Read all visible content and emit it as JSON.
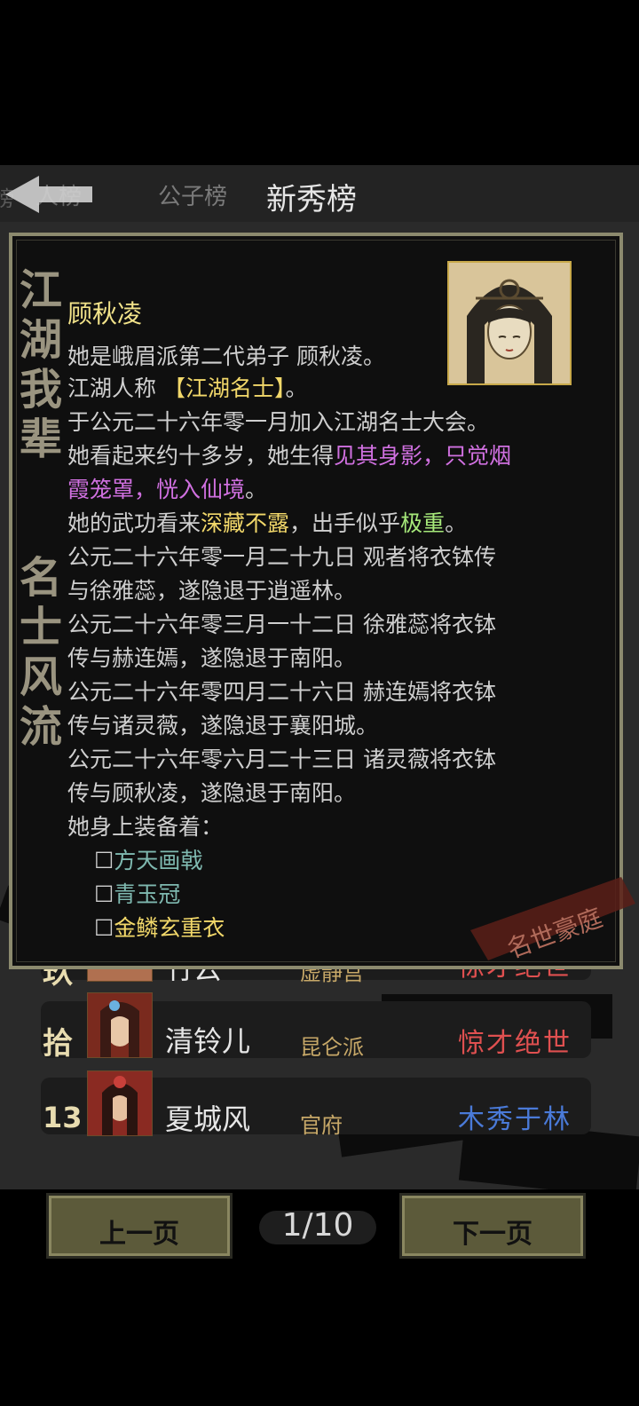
{
  "tabs": {
    "far": "榜",
    "renbang": "人榜",
    "gongzi": "公子榜",
    "xinxiu": "新秀榜"
  },
  "panel": {
    "side_text_1": [
      "江",
      "湖",
      "我",
      "辈"
    ],
    "side_text_2": [
      "名",
      "士",
      "风",
      "流"
    ],
    "name": "顾秋凌",
    "lines": {
      "l1": "她是峨眉派第二代弟子 顾秋凌。",
      "l2a": "江湖人称 ",
      "l2b": "【江湖名士】",
      "l2c": "。",
      "l3": "于公元二十六年零一月加入江湖名士大会。",
      "l4a": "她看起来约十多岁，她生得",
      "l4b": "见其身影，只觉烟",
      "l5a": "霞笼罩，恍入仙境",
      "l5b": "。",
      "l6a": "她的武功看来",
      "l6b": "深藏不露",
      "l6c": "，出手似乎",
      "l6d": "极重",
      "l6e": "。",
      "l7": "公元二十六年零一月二十九日 观者将衣钵传",
      "l8": "与徐雅蕊，遂隐退于逍遥林。",
      "l9": "公元二十六年零三月一十二日 徐雅蕊将衣钵",
      "l10": "传与赫连嫣，遂隐退于南阳。",
      "l11": "公元二十六年零四月二十六日 赫连嫣将衣钵",
      "l12": "传与诸灵薇，遂隐退于襄阳城。",
      "l13": "公元二十六年零六月二十三日 诸灵薇将衣钵",
      "l14": "传与顾秋凌，遂隐退于南阳。",
      "l15": "她身上装备着："
    },
    "equipment": [
      {
        "box": "☐",
        "name": "方天画戟",
        "color": "#7fb9b0"
      },
      {
        "box": "☐",
        "name": "青玉冠",
        "color": "#7fb9b0"
      },
      {
        "box": "☐",
        "name": "金鳞玄重衣",
        "color": "#f2d86a"
      }
    ],
    "stamp_text": "名世豪庭"
  },
  "list": [
    {
      "rank": "玖",
      "name": "竹云",
      "school": "虚静宫",
      "title": "惊才绝世",
      "title_color": "#e05050"
    },
    {
      "rank": "拾",
      "name": "清铃儿",
      "school": "昆仑派",
      "title": "惊才绝世",
      "title_color": "#e05050"
    },
    {
      "rank": "13",
      "name": "夏城风",
      "school": "官府",
      "title": "木秀于林",
      "title_color": "#4a7ad8"
    }
  ],
  "pagination": {
    "prev_label": "上一页",
    "next_label": "下一页",
    "page": "1/10"
  }
}
